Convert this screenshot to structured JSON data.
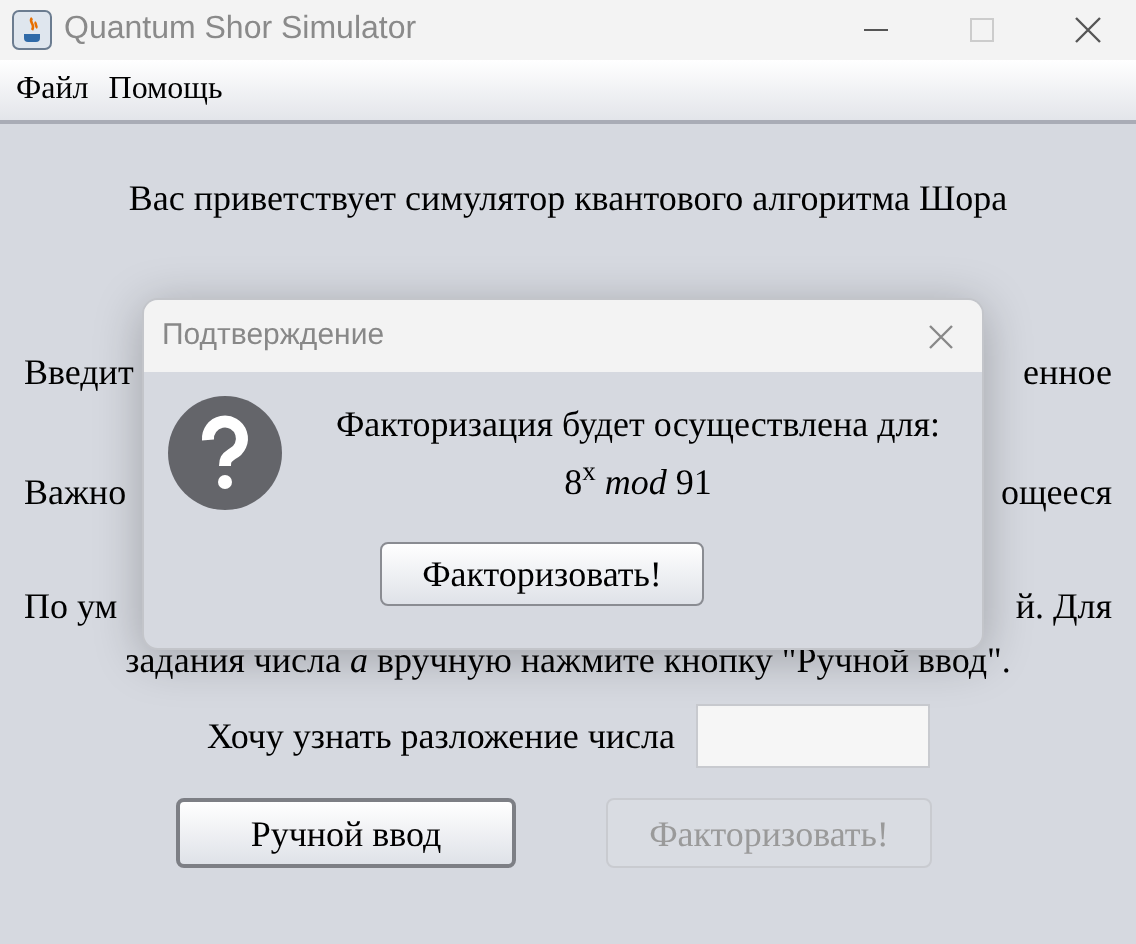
{
  "window": {
    "title": "Quantum Shor Simulator"
  },
  "menu": [
    {
      "label": "Файл"
    },
    {
      "label": "Помощь"
    }
  ],
  "content": {
    "greeting": "Вас приветствует симулятор квантового алгоритма Шора",
    "lines": [
      {
        "left": "Введит",
        "right": "енное"
      },
      {
        "left": "Важно",
        "right": "ощееся"
      },
      {
        "left": "По ум",
        "right": "й. Для"
      }
    ],
    "instruction": "задания числа *a* вручную нажмите кнопку \"Ручной ввод\".",
    "field_label": "Хочу узнать разложение числа",
    "buttons": [
      {
        "label": "Ручной ввод",
        "disabled": false
      },
      {
        "label": "Факторизовать!",
        "disabled": true
      }
    ]
  },
  "dialog": {
    "title": "Подтверждение",
    "message": "Факторизация будет осуществлена для:",
    "formula": "8$^{x}$ *mod* 91",
    "button": "Факторизовать!"
  }
}
